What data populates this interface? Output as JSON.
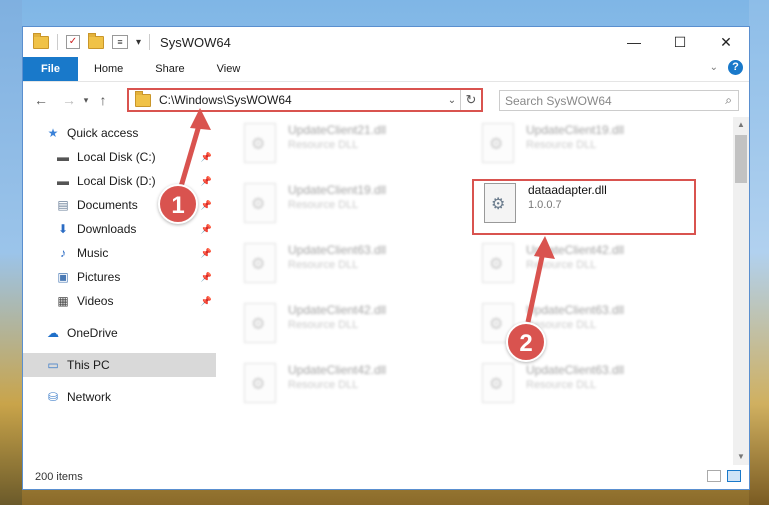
{
  "window": {
    "title": "SysWOW64",
    "minimize_glyph": "—",
    "maximize_glyph": "☐",
    "close_glyph": "✕"
  },
  "ribbon": {
    "tabs": [
      "File",
      "Home",
      "Share",
      "View"
    ]
  },
  "address_bar": {
    "path": "C:\\Windows\\SysWOW64",
    "search_placeholder": "Search SysWOW64"
  },
  "nav_pane": {
    "items": [
      {
        "label": "Quick access",
        "icon": "star-icon"
      },
      {
        "label": "Local Disk (C:)",
        "icon": "drive-icon",
        "pinned": true
      },
      {
        "label": "Local Disk (D:)",
        "icon": "drive-icon",
        "pinned": true
      },
      {
        "label": "Documents",
        "icon": "documents-icon",
        "pinned": true
      },
      {
        "label": "Downloads",
        "icon": "download-icon",
        "pinned": true
      },
      {
        "label": "Music",
        "icon": "music-icon",
        "pinned": true
      },
      {
        "label": "Pictures",
        "icon": "pictures-icon",
        "pinned": true
      },
      {
        "label": "Videos",
        "icon": "videos-icon",
        "pinned": true
      },
      {
        "label": "OneDrive",
        "icon": "cloud-icon"
      },
      {
        "label": "This PC",
        "icon": "computer-icon",
        "selected": true
      },
      {
        "label": "Network",
        "icon": "network-icon"
      }
    ]
  },
  "files": [
    {
      "name": "UpdateClient21.dll",
      "desc": "Resource DLL"
    },
    {
      "name": "UpdateClient19.dll",
      "desc": "Resource DLL"
    },
    {
      "name": "UpdateClient19.dll",
      "desc": "Resource DLL"
    },
    {
      "name": "UpdateClient63.dll",
      "desc": "Resource DLL"
    },
    {
      "name": "UpdateClient42.dll",
      "desc": "Resource DLL"
    },
    {
      "name": "UpdateClient42.dll",
      "desc": "Resource DLL"
    },
    {
      "name": "UpdateClient63.dll",
      "desc": "Resource DLL"
    },
    {
      "name": "UpdateClient42.dll",
      "desc": "Resource DLL"
    },
    {
      "name": "UpdateClient63.dll",
      "desc": "Resource DLL"
    }
  ],
  "highlighted_file": {
    "name": "dataadapter.dll",
    "version": "1.0.0.7"
  },
  "status": {
    "item_count": "200 items"
  },
  "annotations": {
    "step1": "1",
    "step2": "2",
    "color": "#d9534f"
  }
}
